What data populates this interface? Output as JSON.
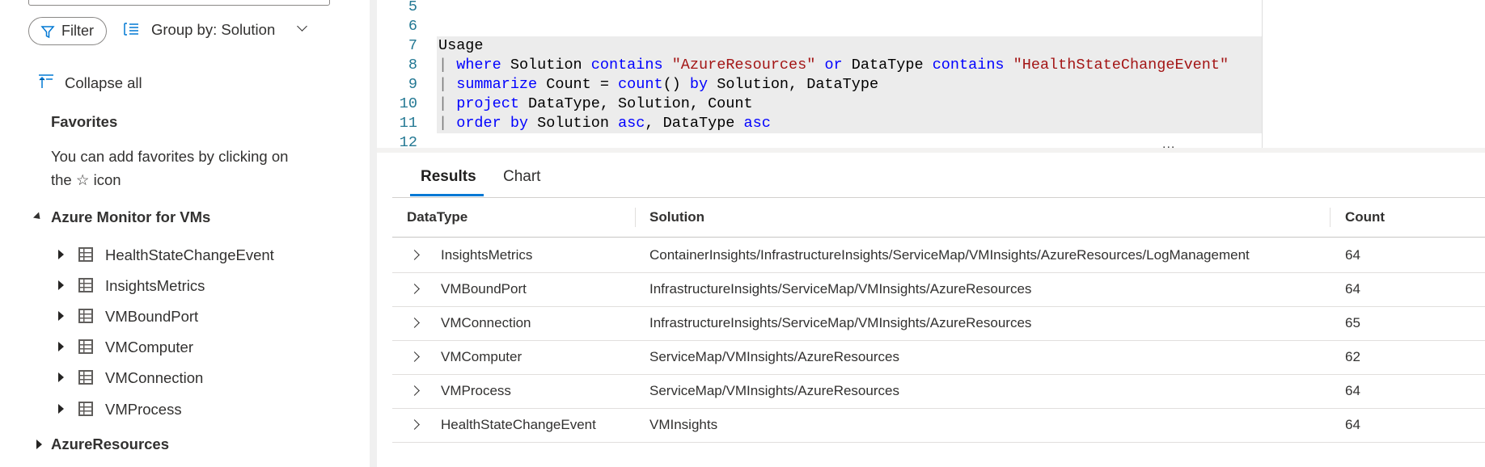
{
  "sidebar": {
    "filter_label": "Filter",
    "group_by_label": "Group by: Solution",
    "collapse_all_label": "Collapse all",
    "favorites_heading": "Favorites",
    "favorites_hint_line1": "You can add favorites by clicking on",
    "favorites_hint_the": "the",
    "favorites_hint_star": "☆",
    "favorites_hint_icon": "icon",
    "groups": [
      {
        "label": "Azure Monitor for VMs",
        "expanded": true,
        "items": [
          "HealthStateChangeEvent",
          "InsightsMetrics",
          "VMBoundPort",
          "VMComputer",
          "VMConnection",
          "VMProcess"
        ]
      },
      {
        "label": "AzureResources",
        "expanded": false
      }
    ]
  },
  "editor": {
    "line_numbers": [
      "5",
      "6",
      "7",
      "8",
      "9",
      "10",
      "11",
      "12"
    ],
    "lines": {
      "l7": "Usage",
      "l8": {
        "pipe": "|",
        "kw1": "where",
        "t1": " Solution ",
        "kw2": "contains",
        "s1": "\"AzureResources\"",
        "kw3": "or",
        "t2": " DataType ",
        "kw4": "contains",
        "s2": "\"HealthStateChangeEvent\""
      },
      "l9": {
        "pipe": "|",
        "kw1": "summarize",
        "t1": " Count = ",
        "kw2": "count",
        "t2": "() ",
        "kw3": "by",
        "t3": " Solution, DataType"
      },
      "l10": {
        "pipe": "|",
        "kw1": "project",
        "t1": " DataType, Solution, Count"
      },
      "l11": {
        "pipe": "|",
        "kw1": "order by",
        "t1": " Solution ",
        "kw2": "asc",
        "t2": ", DataType ",
        "kw3": "asc"
      }
    },
    "splitter_label": "..."
  },
  "results": {
    "tabs": [
      {
        "label": "Results",
        "active": true
      },
      {
        "label": "Chart",
        "active": false
      }
    ],
    "columns": [
      "DataType",
      "Solution",
      "Count"
    ],
    "rows": [
      [
        "InsightsMetrics",
        "ContainerInsights/InfrastructureInsights/ServiceMap/VMInsights/AzureResources/LogManagement",
        "64"
      ],
      [
        "VMBoundPort",
        "InfrastructureInsights/ServiceMap/VMInsights/AzureResources",
        "64"
      ],
      [
        "VMConnection",
        "InfrastructureInsights/ServiceMap/VMInsights/AzureResources",
        "65"
      ],
      [
        "VMComputer",
        "ServiceMap/VMInsights/AzureResources",
        "62"
      ],
      [
        "VMProcess",
        "ServiceMap/VMInsights/AzureResources",
        "64"
      ],
      [
        "HealthStateChangeEvent",
        "VMInsights",
        "64"
      ]
    ]
  },
  "colors": {
    "accent": "#0078d4",
    "keyword": "#0000ff",
    "string": "#a31515",
    "line_number": "#237893"
  }
}
